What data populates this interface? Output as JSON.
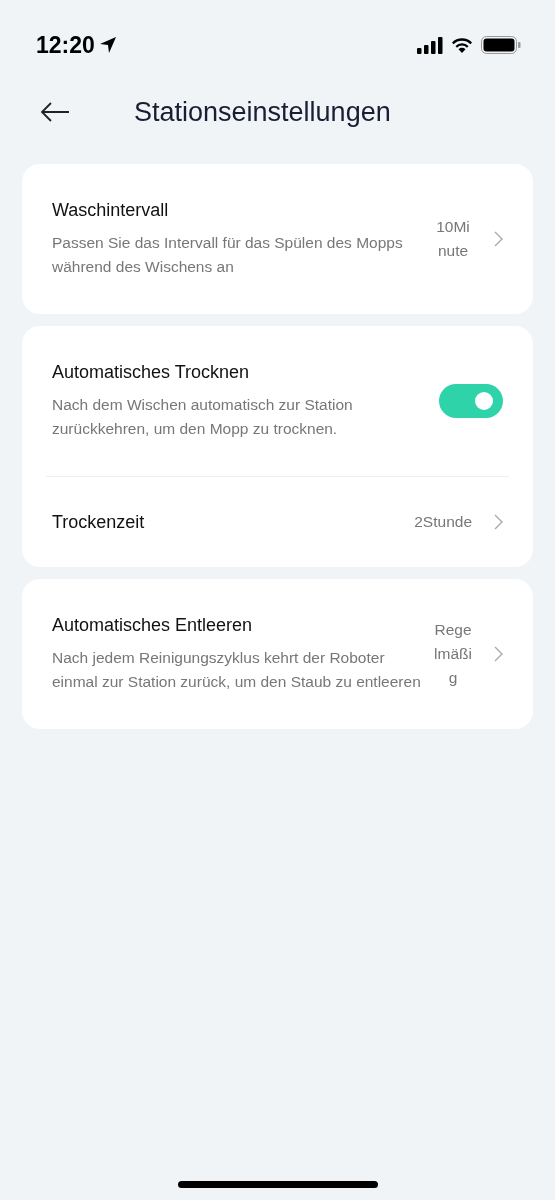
{
  "status_bar": {
    "time": "12:20"
  },
  "header": {
    "title": "Stationseinstellungen"
  },
  "cards": [
    {
      "rows": [
        {
          "kind": "nav",
          "title": "Waschintervall",
          "description": "Passen Sie das Intervall für das Spülen des Mopps während des Wischens an",
          "value": "10Minute"
        }
      ]
    },
    {
      "rows": [
        {
          "kind": "toggle",
          "title": "Automatisches Trocknen",
          "description": "Nach dem Wischen automatisch zur Station zurückkehren, um den Mopp zu trocknen.",
          "on": true
        },
        {
          "kind": "nav",
          "title": "Trockenzeit",
          "value": "2Stunde"
        }
      ]
    },
    {
      "rows": [
        {
          "kind": "nav",
          "title": "Automatisches Entleeren",
          "description": "Nach jedem Reinigungszyklus kehrt der Roboter einmal zur Station zurück, um den Staub zu entleeren",
          "value": "Regelmäßig"
        }
      ]
    }
  ]
}
